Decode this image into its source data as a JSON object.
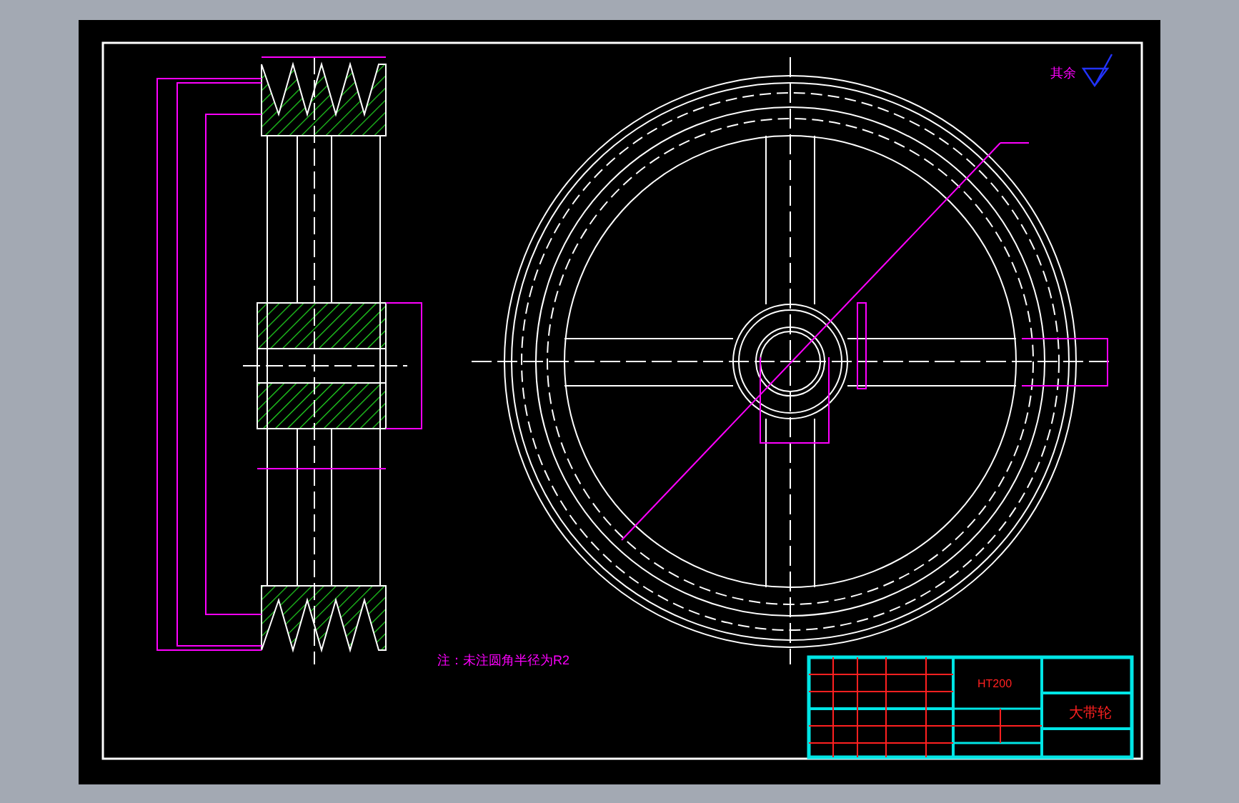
{
  "drawing": {
    "note": "注：未注圆角半径为R2",
    "roughness_label": "其余",
    "title_block": {
      "material": "HT200",
      "part_name": "大带轮"
    }
  }
}
